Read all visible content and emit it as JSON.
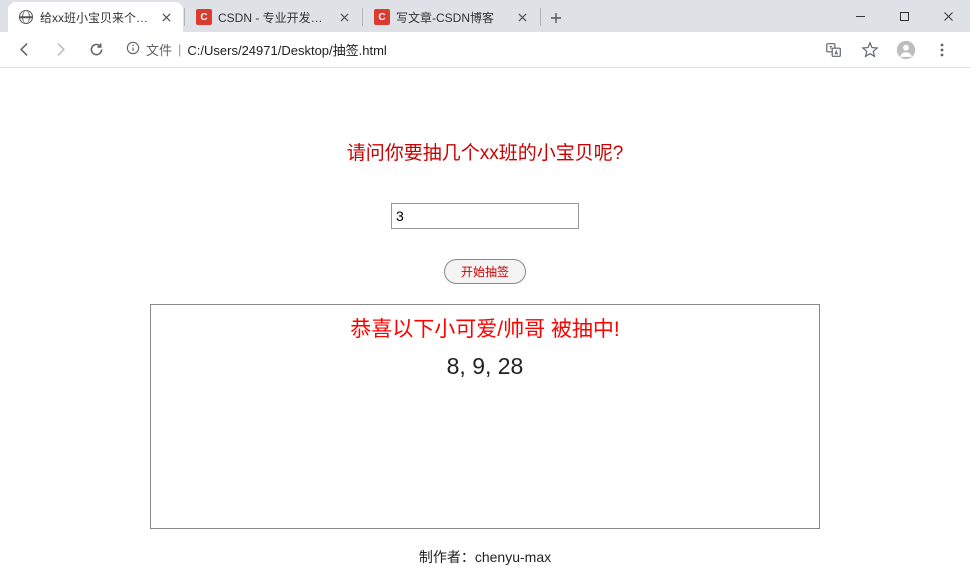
{
  "browser": {
    "tabs": [
      {
        "title": "给xx班小宝贝来个抽签",
        "favicon": "globe",
        "active": true
      },
      {
        "title": "CSDN - 专业开发者社区",
        "favicon": "csdn",
        "active": false
      },
      {
        "title": "写文章-CSDN博客",
        "favicon": "csdn",
        "active": false
      }
    ],
    "url_prefix": "文件",
    "url_path": "C:/Users/24971/Desktop/抽签.html",
    "csdn_favicon_letter": "C"
  },
  "page": {
    "prompt": "请问你要抽几个xx班的小宝贝呢?",
    "input_value": "3",
    "button_label": "开始抽签",
    "congrats": "恭喜以下小可爱/帅哥 被抽中!",
    "result_numbers": "8, 9, 28",
    "author_label": "制作者：chenyu-max"
  }
}
